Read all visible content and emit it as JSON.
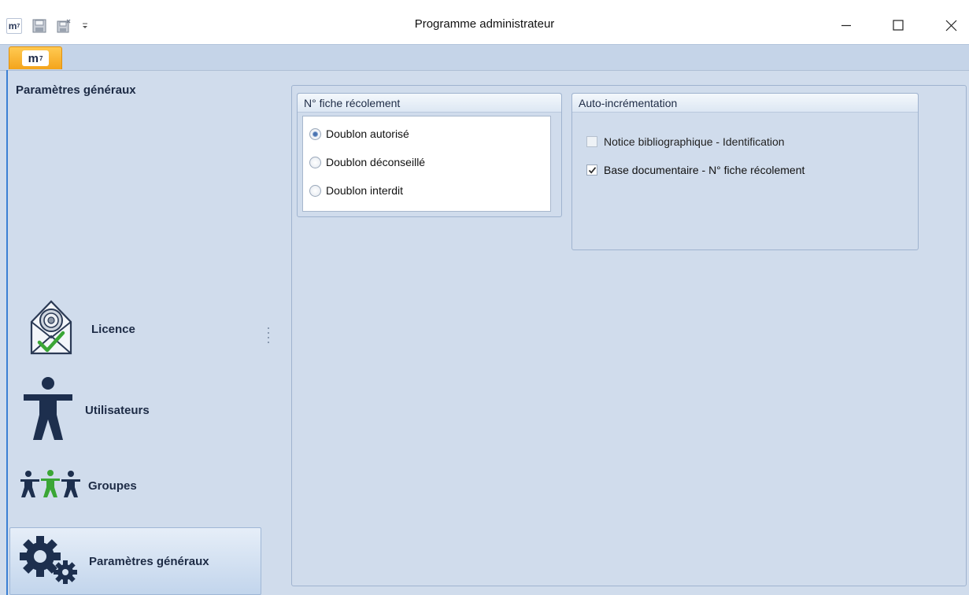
{
  "window": {
    "title": "Programme administrateur",
    "quick_access": [
      "app-m7-icon",
      "save-icon",
      "save-close-icon",
      "customize-dropdown-icon"
    ],
    "app_tab": {
      "text": "m",
      "superscript": "7"
    }
  },
  "nav": {
    "header": "Paramètres généraux",
    "items": [
      {
        "label": "Licence",
        "icon": "licence-icon",
        "selected": false
      },
      {
        "label": "Utilisateurs",
        "icon": "user-icon",
        "selected": false
      },
      {
        "label": "Groupes",
        "icon": "groups-icon",
        "selected": false
      },
      {
        "label": "Paramètres généraux",
        "icon": "gears-icon",
        "selected": true
      }
    ]
  },
  "fiche_group": {
    "title": "N° fiche récolement",
    "options": [
      {
        "label": "Doublon autorisé",
        "checked": true
      },
      {
        "label": "Doublon déconseillé",
        "checked": false
      },
      {
        "label": "Doublon interdit",
        "checked": false
      }
    ]
  },
  "auto_group": {
    "title": "Auto-incrémentation",
    "options": [
      {
        "label": "Notice bibliographique - Identification",
        "checked": false
      },
      {
        "label": "Base documentaire - N° fiche récolement",
        "checked": true
      }
    ]
  },
  "colors": {
    "accent_orange": "#f4a41b",
    "panel_background": "#d0dcec",
    "ribbon": "#c5d4e8",
    "icon_dark": "#1d2f4e",
    "icon_green": "#3aa635"
  }
}
